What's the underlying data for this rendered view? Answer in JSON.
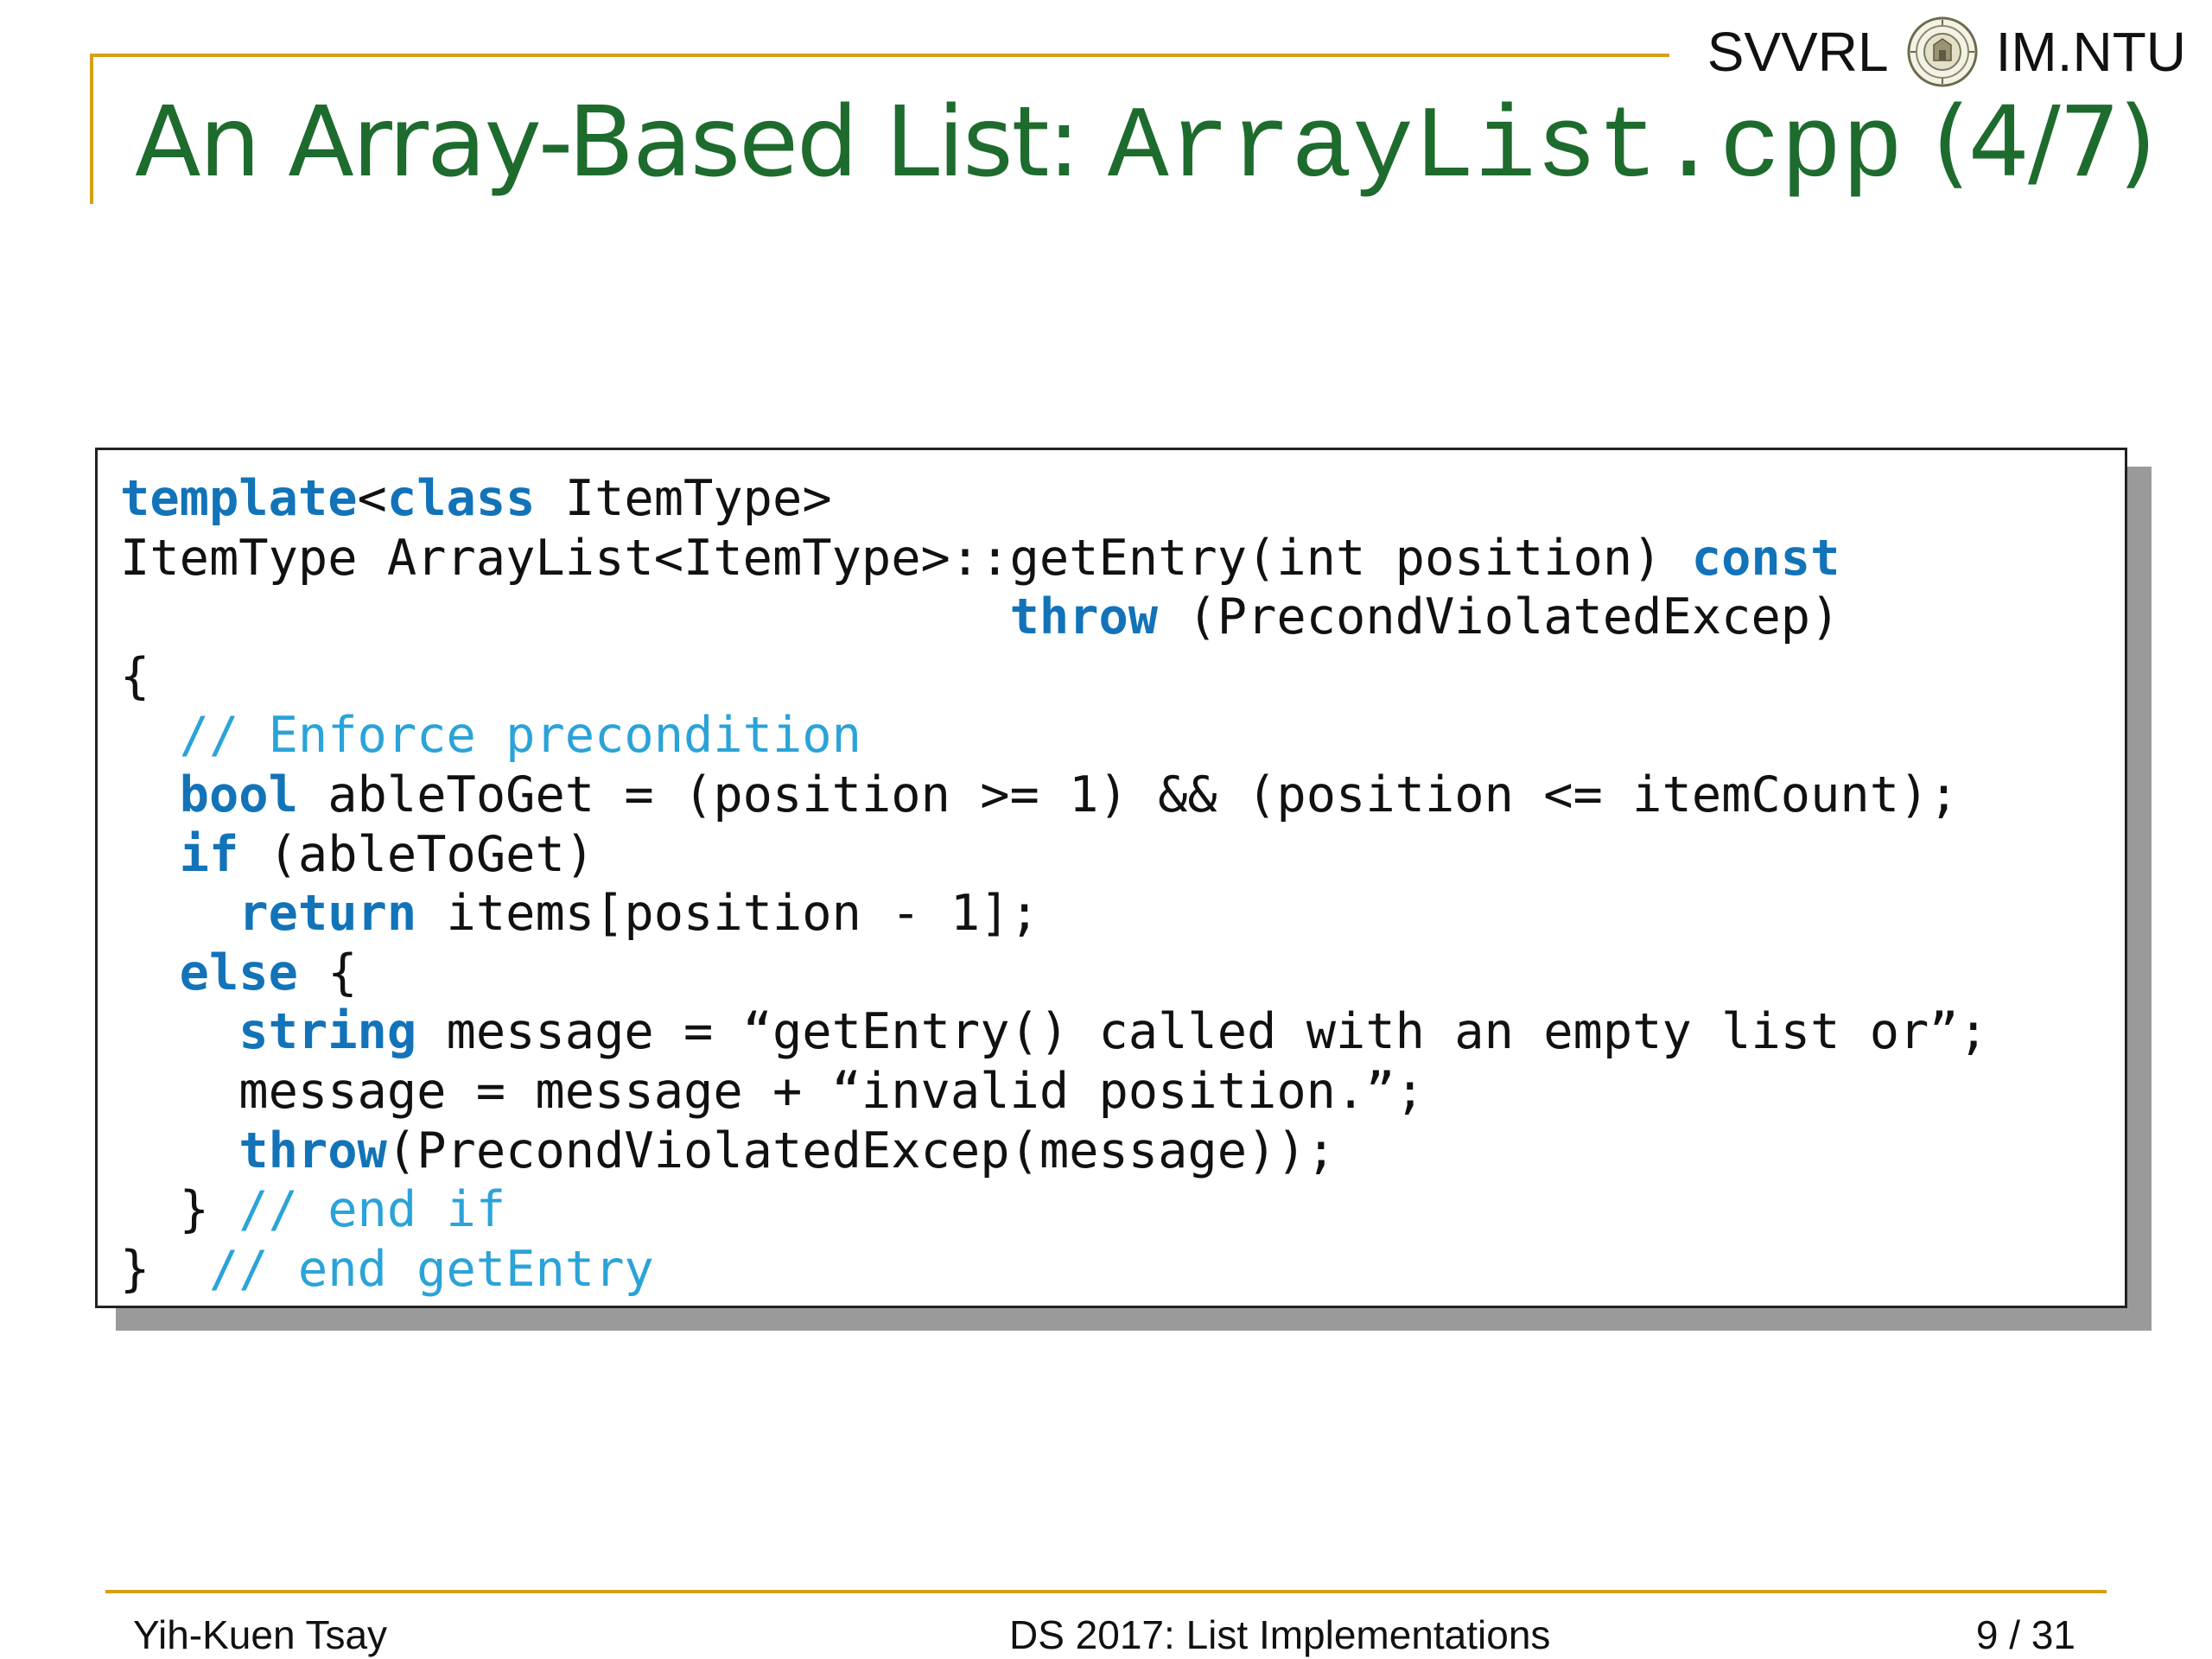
{
  "header": {
    "lab": "SVVRL",
    "university": "IM.NTU",
    "seal_icon": "ntu-seal-icon"
  },
  "slide": {
    "title_prefix": "An Array-Based List: ",
    "title_code": "ArrayList.cpp",
    "title_suffix": " (4/7)"
  },
  "code_lines": [
    [
      {
        "t": "template",
        "c": "kw"
      },
      {
        "t": "<",
        "c": ""
      },
      {
        "t": "class",
        "c": "kw"
      },
      {
        "t": " ItemType>",
        "c": ""
      }
    ],
    [
      {
        "t": "ItemType ArrayList<ItemType>::getEntry(int position) ",
        "c": ""
      },
      {
        "t": "const",
        "c": "kw"
      }
    ],
    [
      {
        "t": "                              ",
        "c": ""
      },
      {
        "t": "throw",
        "c": "kw"
      },
      {
        "t": " (PrecondViolatedExcep)",
        "c": ""
      }
    ],
    [
      {
        "t": "{",
        "c": ""
      }
    ],
    [
      {
        "t": "  ",
        "c": ""
      },
      {
        "t": "// Enforce precondition",
        "c": "cm"
      }
    ],
    [
      {
        "t": "  ",
        "c": ""
      },
      {
        "t": "bool",
        "c": "kw"
      },
      {
        "t": " ableToGet = (position >= 1) && (position <= itemCount);",
        "c": ""
      }
    ],
    [
      {
        "t": "  ",
        "c": ""
      },
      {
        "t": "if",
        "c": "kw"
      },
      {
        "t": " (ableToGet)",
        "c": ""
      }
    ],
    [
      {
        "t": "    ",
        "c": ""
      },
      {
        "t": "return",
        "c": "kw"
      },
      {
        "t": " items[position - 1];",
        "c": ""
      }
    ],
    [
      {
        "t": "  ",
        "c": ""
      },
      {
        "t": "else",
        "c": "kw"
      },
      {
        "t": " {",
        "c": ""
      }
    ],
    [
      {
        "t": "    ",
        "c": ""
      },
      {
        "t": "string",
        "c": "kw"
      },
      {
        "t": " message = “getEntry() called with an empty list or”;",
        "c": ""
      }
    ],
    [
      {
        "t": "    message = message + “invalid position.”;",
        "c": ""
      }
    ],
    [
      {
        "t": "    ",
        "c": ""
      },
      {
        "t": "throw",
        "c": "kw"
      },
      {
        "t": "(PrecondViolatedExcep(message));",
        "c": ""
      }
    ],
    [
      {
        "t": "  } ",
        "c": ""
      },
      {
        "t": "// end if",
        "c": "cm"
      }
    ],
    [
      {
        "t": "}  ",
        "c": ""
      },
      {
        "t": "// end getEntry",
        "c": "cm"
      }
    ]
  ],
  "footer": {
    "author": "Yih-Kuen Tsay",
    "course": "DS 2017: List Implementations",
    "page": "9 / 31"
  },
  "colors": {
    "title": "#1E6B2E",
    "rule": "#D4A017",
    "keyword": "#1273B8",
    "comment": "#2BA3D8"
  }
}
